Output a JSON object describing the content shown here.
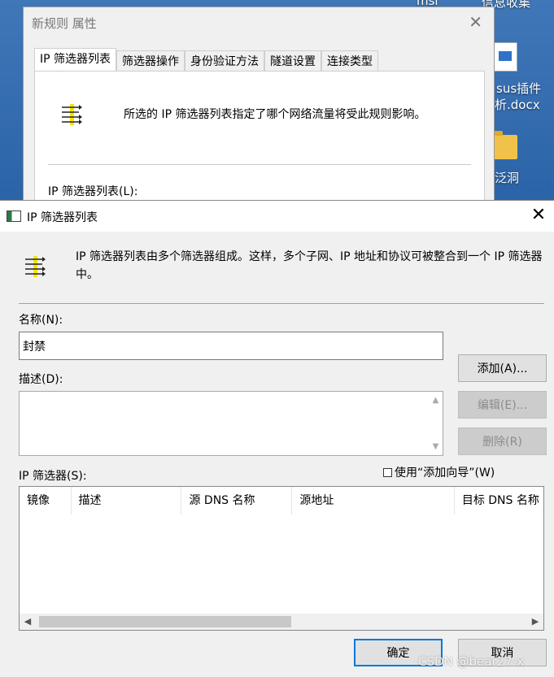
{
  "desktop": {
    "labels": [
      "msi",
      "信息收集",
      "sus插件",
      "析.docx",
      "泛洞"
    ]
  },
  "background_window": {
    "title": "新规则 属性",
    "close": "✕",
    "tabs": [
      "IP 筛选器列表",
      "筛选器操作",
      "身份验证方法",
      "隧道设置",
      "连接类型"
    ],
    "description": "所选的 IP 筛选器列表指定了哪个网络流量将受此规则影响。",
    "list_label": "IP 筛选器列表(L):"
  },
  "dialog": {
    "title": "IP 筛选器列表",
    "close": "✕",
    "intro": "IP 筛选器列表由多个筛选器组成。这样，多个子网、IP 地址和协议可被整合到一个 IP 筛选器中。",
    "name_label": "名称(N):",
    "name_value": "封禁",
    "description_label": "描述(D):",
    "description_value": "",
    "buttons": {
      "add": "添加(A)...",
      "edit": "编辑(E)...",
      "remove": "删除(R)",
      "ok": "确定",
      "cancel": "取消"
    },
    "filters_label": "IP 筛选器(S):",
    "wizard_checkbox": "使用“添加向导”(W)",
    "wizard_checked": false,
    "columns": [
      "镜像",
      "描述",
      "源 DNS 名称",
      "源地址",
      "目标 DNS 名称"
    ],
    "rows": []
  },
  "watermark": "CSDN @bear27-x",
  "colors": {
    "accent": "#0078d7",
    "dialog_bg": "#f0f0f0"
  }
}
